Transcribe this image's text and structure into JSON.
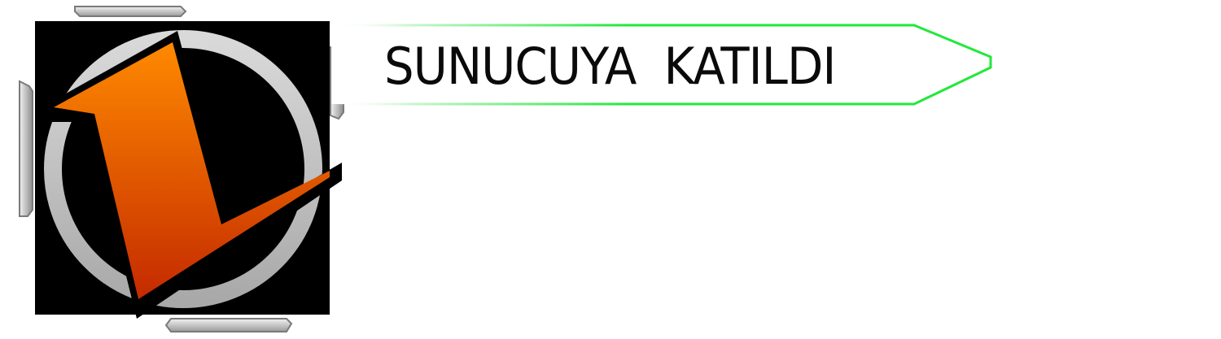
{
  "notification": {
    "message": "SUNUCUYA KATILDI"
  },
  "avatar": {
    "logo_name": "orange-l-logo-icon",
    "ring_color": "#c8c8c8",
    "background_color": "#000000",
    "logo_gradient_top": "#ff8a00",
    "logo_gradient_bottom": "#c42a00"
  },
  "banner": {
    "accent_color": "#22e83a"
  }
}
